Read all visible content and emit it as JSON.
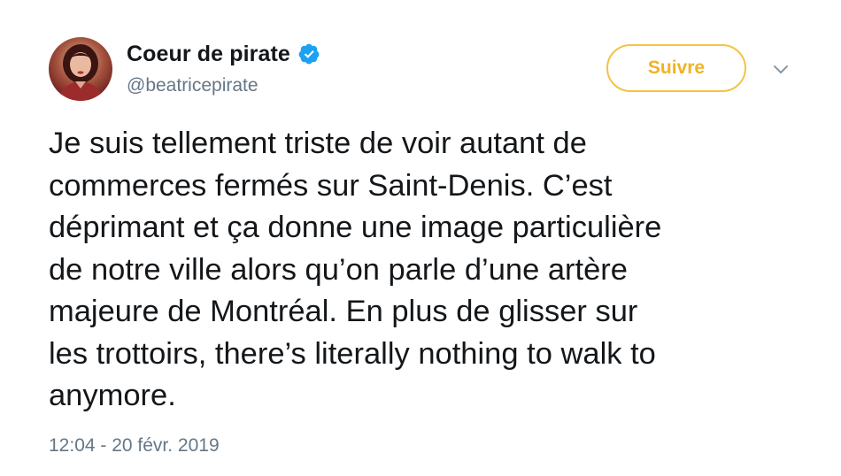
{
  "author": {
    "display_name": "Coeur de pirate",
    "handle": "@beatricepirate",
    "verified": true,
    "avatar_icon": "profile-photo"
  },
  "follow_button": {
    "label": "Suivre",
    "color": "#f0b323"
  },
  "menu": {
    "icon": "chevron-down-icon"
  },
  "tweet": {
    "lines": [
      "Je suis tellement triste de voir autant de",
      "commerces fermés sur Saint-Denis. C’est",
      "déprimant et ça donne une image particulière",
      "de notre ville alors qu’on parle d’une artère",
      "majeure de Montréal. En plus de glisser sur",
      "les trottoirs, there’s literally nothing to walk to",
      "anymore."
    ],
    "timestamp": "12:04 - 20 févr. 2019"
  },
  "colors": {
    "text": "#14171a",
    "secondary": "#657786",
    "verified_blue": "#1da1f2",
    "follow_border": "#f5c242"
  }
}
